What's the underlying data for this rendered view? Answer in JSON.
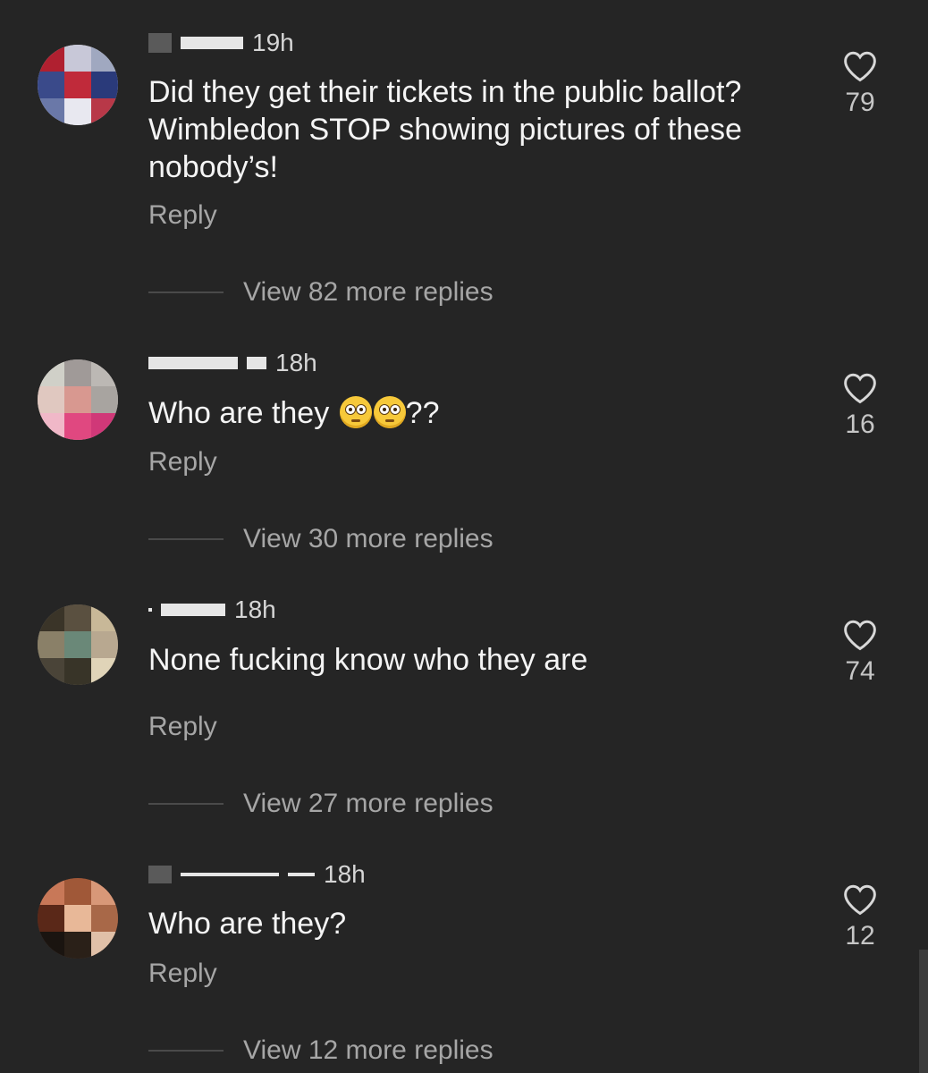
{
  "comments": [
    {
      "time": "19h",
      "text": "Did they get their tickets in the public ballot? Wimbledon STOP showing pictures of these nobody’s!",
      "reply": "Reply",
      "likes": "79",
      "view_replies": "View 82 more replies"
    },
    {
      "time": "18h",
      "text": "Who are they",
      "text_suffix": "??",
      "reply": "Reply",
      "likes": "16",
      "view_replies": "View 30 more replies"
    },
    {
      "time": "18h",
      "text": "None fucking know who they are",
      "reply": "Reply",
      "likes": "74",
      "view_replies": "View 27 more replies"
    },
    {
      "time": "18h",
      "text": "Who are they?",
      "reply": "Reply",
      "likes": "12",
      "view_replies": "View 12 more replies"
    }
  ],
  "icons": {
    "like": "heart-outline-icon",
    "emoji": "flushed-face-emoji"
  },
  "colors": {
    "background": "#252525",
    "text": "#f4f4f4",
    "muted": "#a6a6a6"
  }
}
